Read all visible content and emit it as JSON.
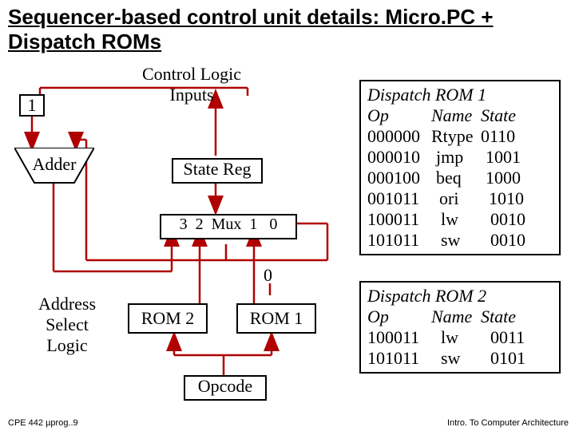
{
  "title": "Sequencer-based control unit details: Micro.PC + Dispatch ROMs",
  "diagram": {
    "one_label": "1",
    "adder_label": "Adder",
    "control_logic_l1": "Control Logic",
    "control_logic_l2": "Inputs",
    "state_reg": "State Reg",
    "mux_3": "3",
    "mux_2": "2",
    "mux_word": "Mux",
    "mux_1": "1",
    "mux_0": "0",
    "zero_label": "0",
    "rom2_label": "ROM 2",
    "rom1_label": "ROM 1",
    "address_select_l1": "Address",
    "address_select_l2": "Select",
    "address_select_l3": "Logic",
    "opcode_label": "Opcode"
  },
  "rom1": {
    "title": "Dispatch ROM 1",
    "h1": "Op",
    "h2": "Name",
    "h3": "State",
    "rows": [
      {
        "op": "000000",
        "name": "Rtype",
        "state": "0110"
      },
      {
        "op": "000010",
        "name": "jmp",
        "state": "1001"
      },
      {
        "op": "000100",
        "name": "beq",
        "state": "1000"
      },
      {
        "op": "001011",
        "name": "ori",
        "state": "1010"
      },
      {
        "op": "100011",
        "name": "lw",
        "state": "0010"
      },
      {
        "op": "101011",
        "name": "sw",
        "state": "0010"
      }
    ]
  },
  "rom2": {
    "title": "Dispatch ROM 2",
    "h1": "Op",
    "h2": "Name",
    "h3": "State",
    "rows": [
      {
        "op": "100011",
        "name": "lw",
        "state": "0011"
      },
      {
        "op": "101011",
        "name": "sw",
        "state": "0101"
      }
    ]
  },
  "footer_left": "CPE 442  µprog..9",
  "footer_right": "Intro. To Computer Architecture"
}
